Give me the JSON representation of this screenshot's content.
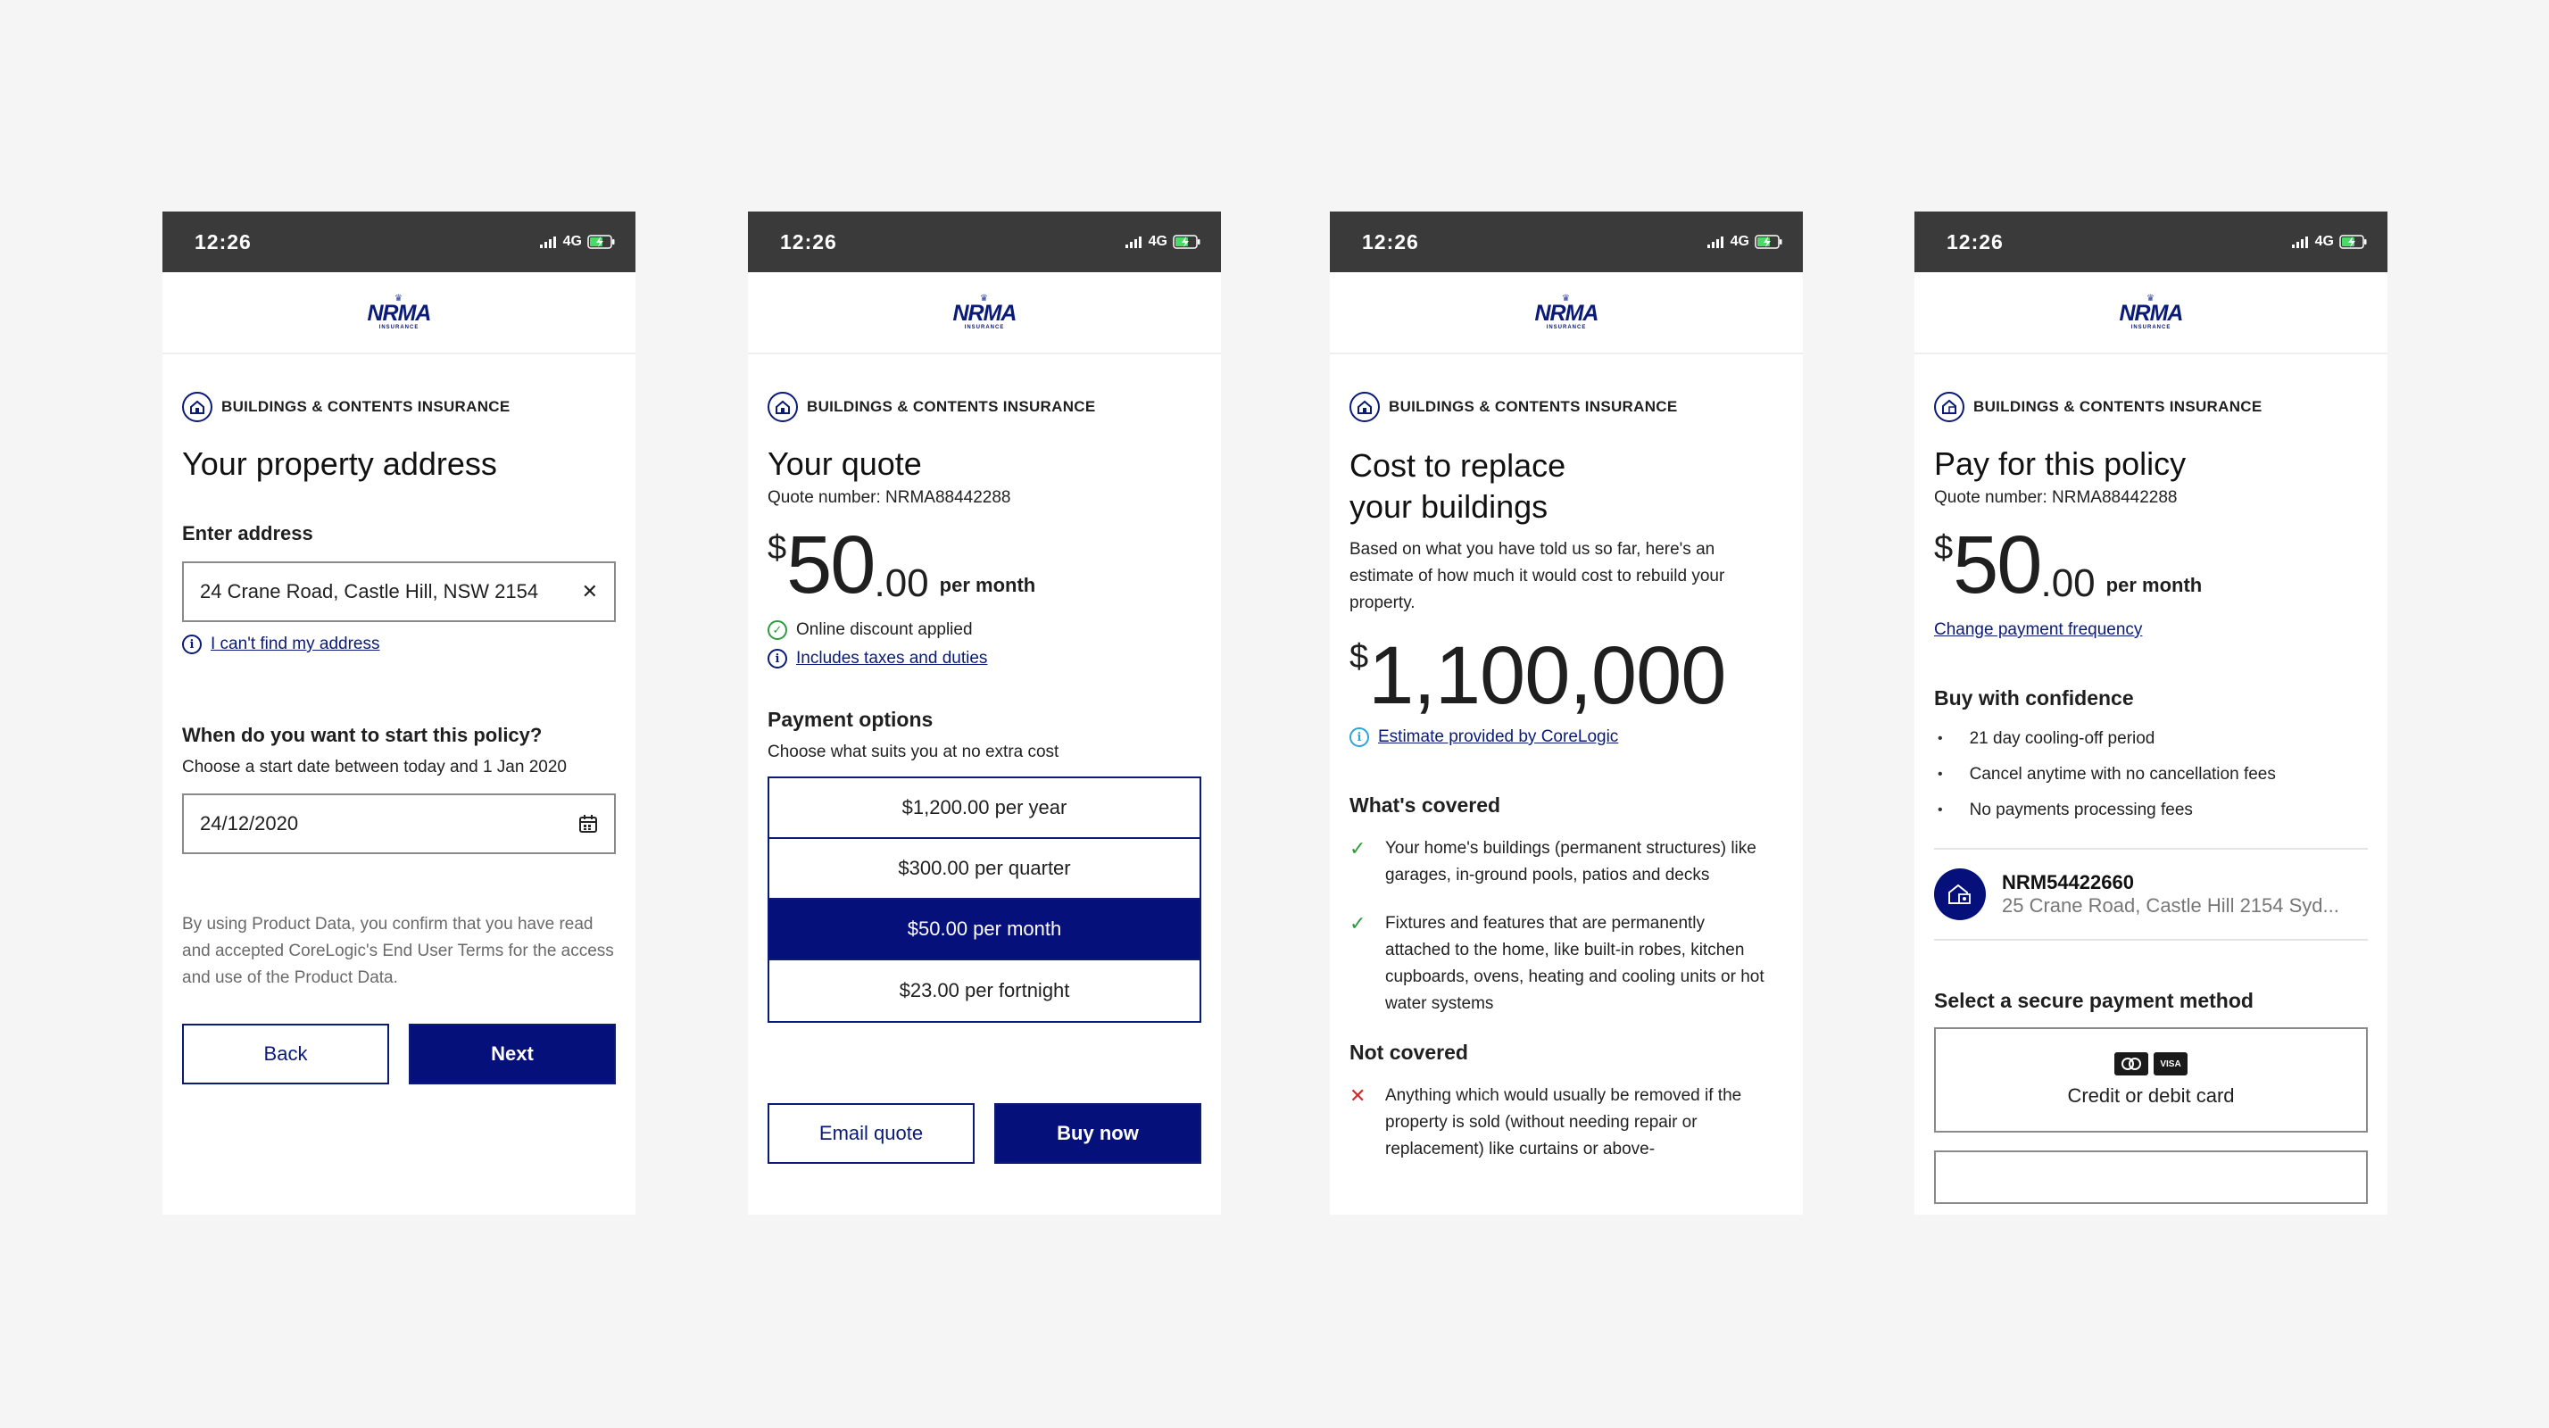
{
  "status": {
    "time": "12:26",
    "network": "4G"
  },
  "brand": {
    "logo_text": "NRMA",
    "logo_sub": "INSURANCE",
    "color": "#06107a"
  },
  "product_label": "BUILDINGS & CONTENTS INSURANCE",
  "screen1": {
    "title": "Your property address",
    "address_label": "Enter address",
    "address_value": "24 Crane Road, Castle Hill, NSW 2154",
    "cant_find": "I can't find my address",
    "start_question": "When do you want to start this policy?",
    "start_hint": "Choose a start date between today and 1 Jan 2020",
    "date_value": "24/12/2020",
    "disclaimer": "By using Product Data, you confirm that you have read and accepted CoreLogic's End User Terms for the access and use of the Product Data.",
    "back_label": "Back",
    "next_label": "Next"
  },
  "screen2": {
    "title": "Your quote",
    "quote_number": "Quote number: NRMA88442288",
    "price_currency": "$",
    "price_dollars": "50",
    "price_cents": ".00",
    "price_unit": "per month",
    "discount": "Online discount applied",
    "taxes_link": "Includes taxes and duties",
    "payment_title": "Payment options",
    "payment_hint": "Choose what suits you at no extra cost",
    "options": [
      {
        "label": "$1,200.00 per year"
      },
      {
        "label": "$300.00 per quarter"
      },
      {
        "label": "$50.00 per month"
      },
      {
        "label": "$23.00 per fortnight"
      }
    ],
    "selected_option": 2,
    "email_label": "Email quote",
    "buy_label": "Buy now"
  },
  "screen3": {
    "title_line1": "Cost to replace",
    "title_line2": "your buildings",
    "intro": "Based on what you have told us so far, here's an estimate of how much it would cost to rebuild your property.",
    "amount_currency": "$",
    "amount": "1,100,000",
    "estimate_link": "Estimate provided by CoreLogic",
    "covered_title": "What's covered",
    "covered_items": [
      "Your home's buildings (permanent structures) like garages, in-ground pools, patios and decks",
      "Fixtures and features that are permanently attached to the home, like built-in robes, kitchen cupboards, ovens, heating and cooling units or hot water systems"
    ],
    "not_covered_title": "Not covered",
    "not_covered_items": [
      "Anything which would usually be removed if the property is sold (without needing repair or replacement) like curtains or above-"
    ]
  },
  "screen4": {
    "title": "Pay for this policy",
    "quote_number": "Quote number: NRMA88442288",
    "price_currency": "$",
    "price_dollars": "50",
    "price_cents": ".00",
    "price_unit": "per month",
    "change_link": "Change payment frequency",
    "confidence_title": "Buy with confidence",
    "confidence_items": [
      "21 day cooling-off period",
      "Cancel anytime with no cancellation fees",
      "No payments processing fees"
    ],
    "policy_id": "NRM54422660",
    "policy_address": "25 Crane Road, Castle Hill 2154 Syd...",
    "payment_method_title": "Select a secure payment method",
    "card_brand_visa": "VISA",
    "card_label": "Credit or debit card"
  }
}
